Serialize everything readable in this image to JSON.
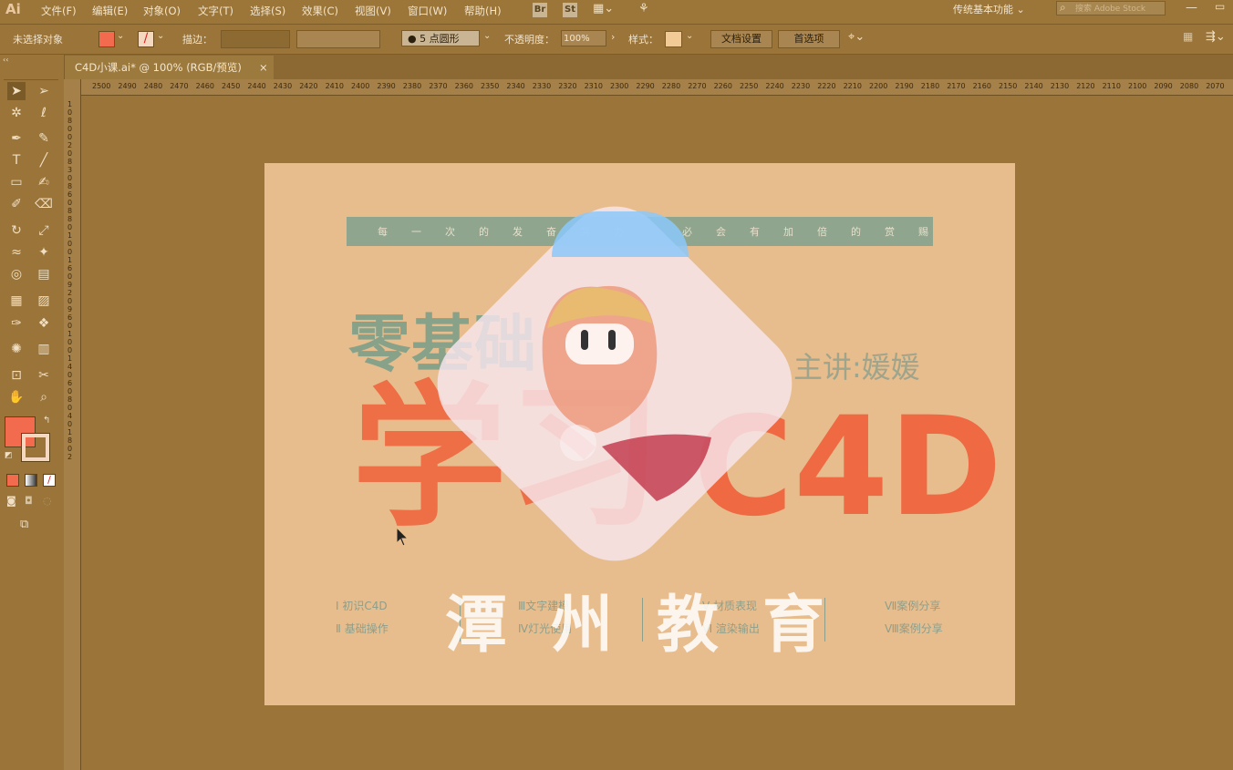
{
  "app": {
    "logo": "Ai"
  },
  "menu": [
    "文件(F)",
    "编辑(E)",
    "对象(O)",
    "文字(T)",
    "选择(S)",
    "效果(C)",
    "视图(V)",
    "窗口(W)",
    "帮助(H)"
  ],
  "menubar_icons": {
    "br": "Br",
    "st": "St"
  },
  "workspace": "传统基本功能",
  "search_placeholder": "搜索 Adobe Stock",
  "control": {
    "selection": "未选择对象",
    "stroke_label": "描边：",
    "brush": "5 点圆形",
    "opacity_label": "不透明度：",
    "opacity_value": "100%",
    "style_label": "样式：",
    "doc_settings": "文档设置",
    "preferences": "首选项"
  },
  "doc_tab": {
    "title": "C4D小课.ai* @ 100% (RGB/预览)",
    "close": "×"
  },
  "ruler_labels": [
    "2500",
    "2490",
    "2480",
    "2470",
    "2460",
    "2450",
    "2440",
    "2430",
    "2420",
    "2410",
    "2400",
    "2390",
    "2380",
    "2370",
    "2360",
    "2350",
    "2340",
    "2330",
    "2320",
    "2310",
    "2300",
    "2290",
    "2280",
    "2270",
    "2260",
    "2250",
    "2240",
    "2230",
    "2220",
    "2210",
    "2200",
    "2190",
    "2180",
    "2170",
    "2160",
    "2150",
    "2140",
    "2130",
    "2120",
    "2110",
    "2100",
    "2090",
    "2080",
    "2070"
  ],
  "artboard": {
    "slogan_left": "每一次的发奋努力",
    "slogan_right": "必会有加倍的赏赐",
    "title_zero": "零基础",
    "title_main": "学习",
    "title_c4d": "C4D",
    "teacher": "主讲:媛媛",
    "courses": [
      {
        "top": "Ⅰ 初识C4D",
        "bottom": "Ⅱ 基础操作"
      },
      {
        "top": "Ⅲ文字建模",
        "bottom": "Ⅳ灯光使用"
      },
      {
        "top": "Ⅴ 材质表现",
        "bottom": "Ⅵ 渲染输出"
      },
      {
        "top": "Ⅶ案例分享",
        "bottom": "Ⅷ案例分享"
      }
    ],
    "watermark": "潭州教育"
  },
  "colors": {
    "fill": "#f26b4f",
    "accent_green": "#8fa58d",
    "accent_orange": "#ee6e45",
    "artboard": "#e8bd8e"
  }
}
